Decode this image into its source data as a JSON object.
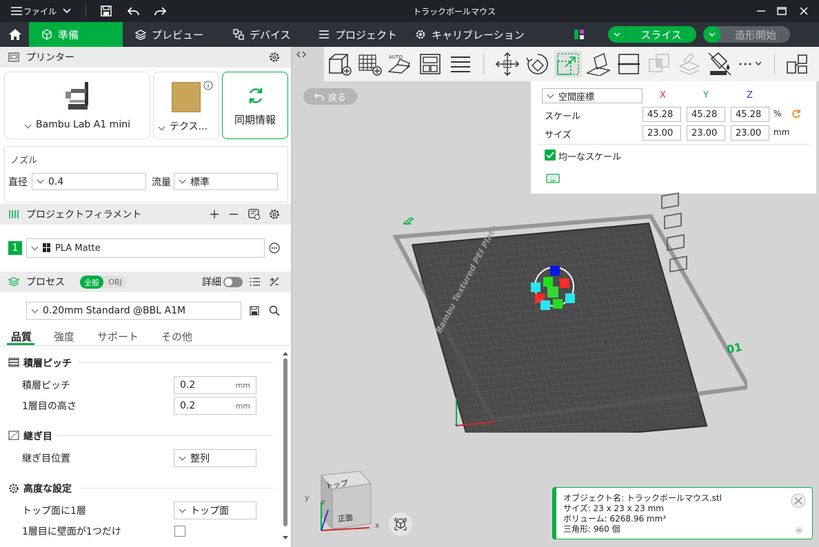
{
  "titlebar": {
    "menu": "ファイル",
    "title": "トラックボールマウス"
  },
  "tabs": [
    {
      "label": "準備"
    },
    {
      "label": "プレビュー"
    },
    {
      "label": "デバイス"
    },
    {
      "label": "プロジェクト"
    },
    {
      "label": "キャリブレーション"
    }
  ],
  "actions": {
    "slice": "スライス",
    "print": "造形開始"
  },
  "printer": {
    "header": "プリンター",
    "model": "Bambu Lab A1 mini",
    "plate": "テクス...",
    "sync": "同期情報"
  },
  "nozzle": {
    "header": "ノズル",
    "diameter_label": "直径",
    "diameter": "0.4",
    "flow_label": "流量",
    "flow": "標準"
  },
  "filament": {
    "header": "プロジェクトフィラメント",
    "slot": "1",
    "name": "PLA Matte"
  },
  "process": {
    "header": "プロセス",
    "mode_all": "全般",
    "mode_obj": "OBJ",
    "detail": "詳細",
    "preset": "0.20mm Standard @BBL A1M",
    "tabs": [
      "品質",
      "強度",
      "サポート",
      "その他"
    ],
    "sec_layer": "積層ピッチ",
    "layer_h_label": "積層ピッチ",
    "layer_h": "0.2",
    "first_h_label": "1層目の高さ",
    "first_h": "0.2",
    "unit": "mm",
    "sec_seam": "継ぎ目",
    "seam_label": "継ぎ目位置",
    "seam": "整列",
    "sec_adv": "高度な設定",
    "top_one_label": "トップ面に1層",
    "top_one": "トップ面",
    "first_wall_label": "1層目に壁面が1つだけ"
  },
  "viewport": {
    "back": "戻る",
    "coord": "空間座標",
    "x": "X",
    "y": "Y",
    "z": "Z",
    "scale_label": "スケール",
    "scale_x": "45.28",
    "scale_y": "45.28",
    "scale_z": "45.28",
    "pct": "%",
    "size_label": "サイズ",
    "size_x": "23.00",
    "size_y": "23.00",
    "size_z": "23.00",
    "mm": "mm",
    "uniform": "均一なスケール",
    "plate_text": "Bambu Textured PEI Plate",
    "plate_num": "01",
    "cube_top": "トップ",
    "cube_front": "正面",
    "axis_x": "x",
    "axis_y": "y",
    "axis_z": "z"
  },
  "info": {
    "name": "オブジェクト名: トラックボールマウス.stl",
    "size": "サイズ: 23 x 23 x 23 mm",
    "volume": "ボリューム: 6268.96 mm³",
    "tris": "三角形: 960 個"
  },
  "colors": {
    "accent": "#00ae42",
    "dark": "#2d3238"
  }
}
